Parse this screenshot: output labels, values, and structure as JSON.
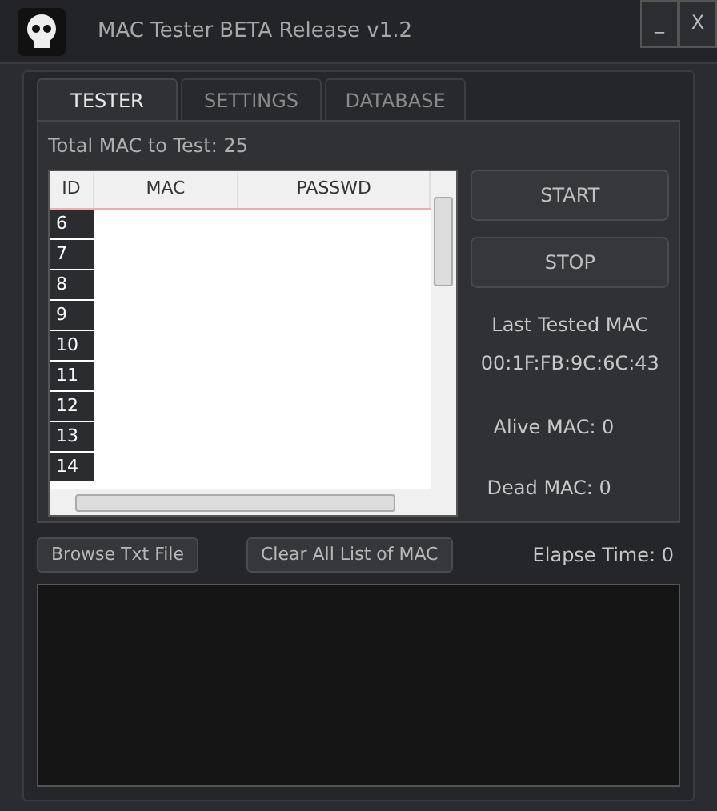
{
  "window": {
    "title": "MAC Tester BETA Release v1.2",
    "controls": [
      "_",
      "X"
    ]
  },
  "tabs": [
    {
      "label": "TESTER",
      "selected": true
    },
    {
      "label": "SETTINGS",
      "selected": false
    },
    {
      "label": "DATABASE",
      "selected": false
    }
  ],
  "total_label": "Total MAC to Test: 25",
  "table": {
    "columns": [
      "ID",
      "MAC",
      "PASSWD"
    ],
    "rows": [
      "6",
      "7",
      "8",
      "9",
      "10",
      "11",
      "12",
      "13",
      "14"
    ]
  },
  "buttons": [
    "START",
    "STOP"
  ],
  "last_tested": {
    "label": "Last Tested MAC",
    "value": "00:1F:FB:9C:6C:43"
  },
  "alive": "Alive MAC: 0",
  "dead": "Dead MAC: 0",
  "bottom_buttons": [
    "Browse Txt File",
    "Clear All List of MAC"
  ],
  "elapse": "Elapse Time: 0"
}
